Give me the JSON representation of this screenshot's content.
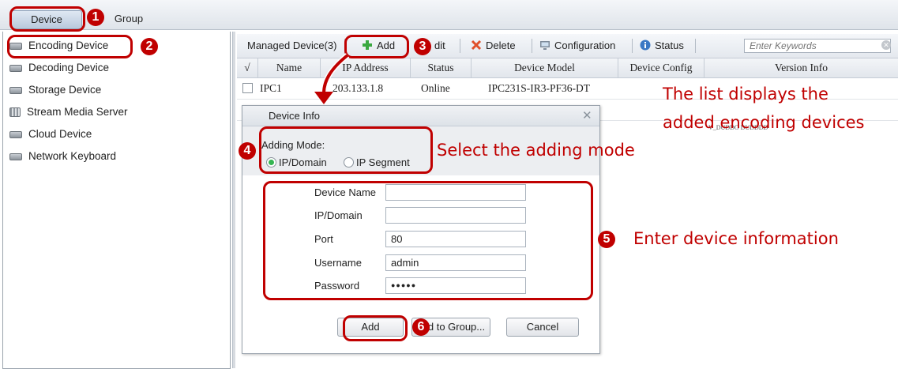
{
  "top_tabs": {
    "device": "Device",
    "group": "Group"
  },
  "sidebar": {
    "items": [
      {
        "label": "Encoding Device",
        "icon": "device-icon"
      },
      {
        "label": "Decoding Device",
        "icon": "device-icon"
      },
      {
        "label": "Storage Device",
        "icon": "device-icon"
      },
      {
        "label": "Stream Media Server",
        "icon": "server-icon"
      },
      {
        "label": "Cloud Device",
        "icon": "device-icon"
      },
      {
        "label": "Network Keyboard",
        "icon": "device-icon"
      }
    ]
  },
  "toolbar": {
    "managed": "Managed Device(3)",
    "add": "Add",
    "edit_partial": "dit",
    "delete": "Delete",
    "configuration": "Configuration",
    "status": "Status",
    "search_placeholder": "Enter Keywords"
  },
  "table": {
    "headers": [
      "√",
      "Name",
      "IP Address",
      "Status",
      "Device Model",
      "Device Config",
      "Version Info"
    ],
    "rows": [
      {
        "name": "IPC1",
        "ip": "203.133.1.8",
        "status": "Online",
        "model": "IPC231S-IR3-PF36-DT"
      }
    ],
    "partial_row_text": "V_DUDDO DUDDDD"
  },
  "dialog": {
    "title": "Device Info",
    "adding_mode_label": "Adding Mode:",
    "mode_ip_domain": "IP/Domain",
    "mode_ip_segment": "IP Segment",
    "fields": {
      "device_name": {
        "label": "Device Name",
        "value": ""
      },
      "ip_domain": {
        "label": "IP/Domain",
        "value": ""
      },
      "port": {
        "label": "Port",
        "value": "80"
      },
      "username": {
        "label": "Username",
        "value": "admin"
      },
      "password": {
        "label": "Password",
        "value": "●●●●●"
      }
    },
    "buttons": {
      "add": "Add",
      "add_to_group_partial": "d to Group...",
      "cancel": "Cancel"
    }
  },
  "annotations": {
    "steps": [
      "1",
      "2",
      "3",
      "4",
      "5",
      "6"
    ],
    "list_note_line1": "The list displays the",
    "list_note_line2": "added encoding devices",
    "mode_note": "Select the adding mode",
    "info_note": "Enter device information",
    "color": "#c00000"
  }
}
